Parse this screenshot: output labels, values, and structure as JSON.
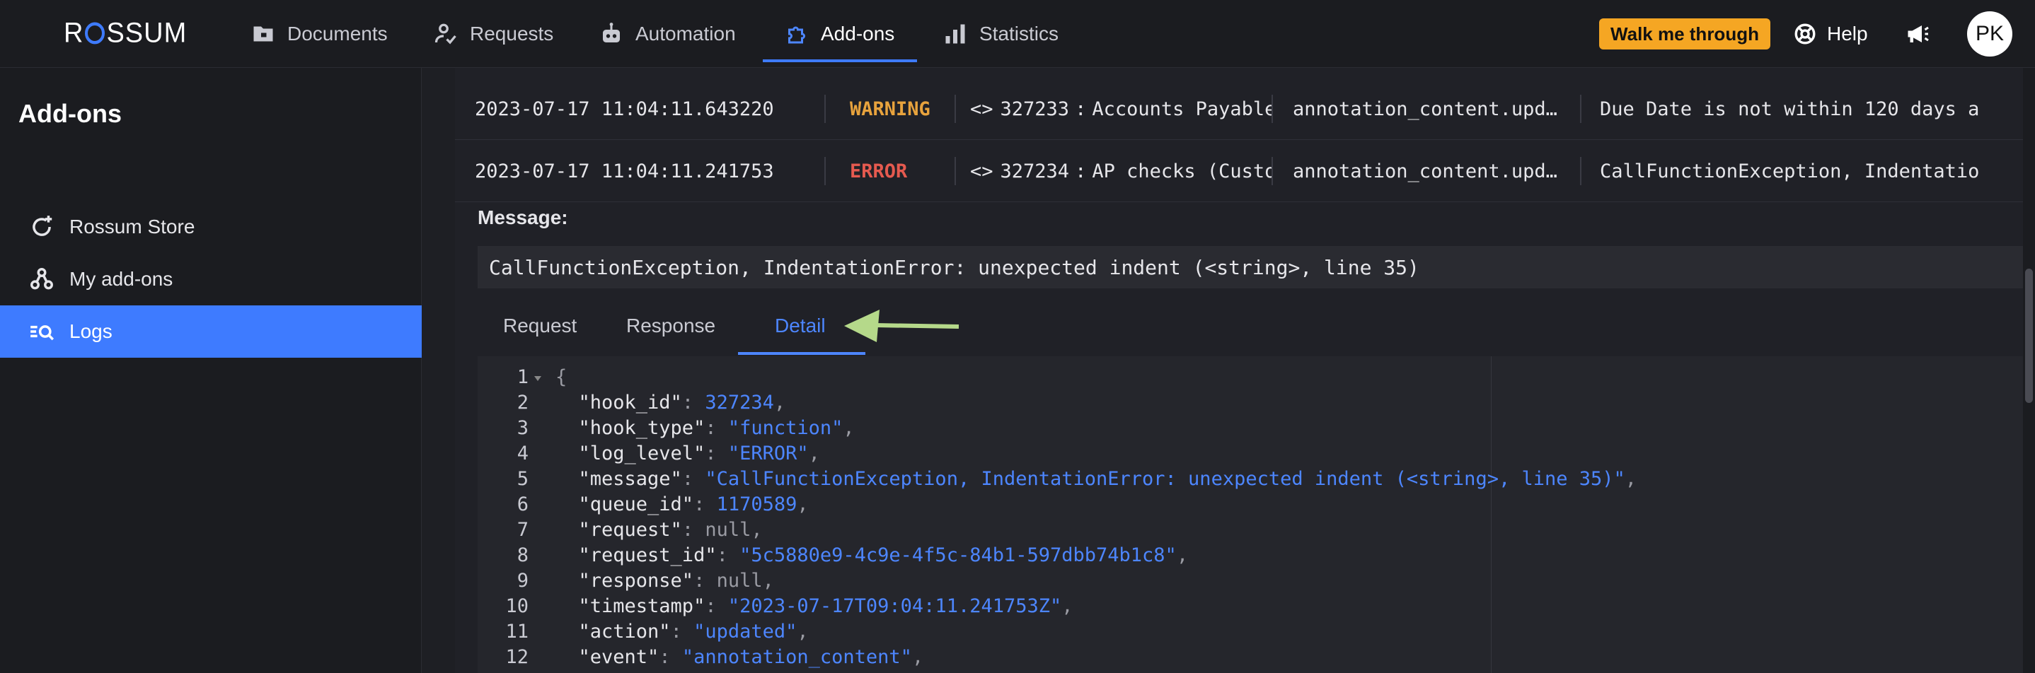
{
  "app": {
    "logo_text": "ROSSUM"
  },
  "nav": {
    "items": [
      {
        "label": "Documents",
        "icon": "folder-icon"
      },
      {
        "label": "Requests",
        "icon": "user-check-icon"
      },
      {
        "label": "Automation",
        "icon": "robot-icon"
      },
      {
        "label": "Add-ons",
        "icon": "puzzle-icon",
        "active": true
      },
      {
        "label": "Statistics",
        "icon": "bar-chart-icon"
      }
    ],
    "walk_label": "Walk me through",
    "help_label": "Help",
    "avatar_initials": "PK"
  },
  "sidebar": {
    "title": "Add-ons",
    "items": [
      {
        "label": "Rossum Store",
        "icon": "refresh-plus-icon"
      },
      {
        "label": "My add-ons",
        "icon": "nodes-icon"
      },
      {
        "label": "Logs",
        "icon": "search-list-icon",
        "active": true
      }
    ]
  },
  "logs": {
    "rows": [
      {
        "timestamp": "2023-07-17 11:04:11.643220",
        "level": "WARNING",
        "hook_id": "327233",
        "hook_name": "Accounts Payable",
        "event": "annotation_content.upd…",
        "message": "Due Date is not within 120 days a"
      },
      {
        "timestamp": "2023-07-17 11:04:11.241753",
        "level": "ERROR",
        "hook_id": "327234",
        "hook_name": "AP checks (Custo",
        "event": "annotation_content.upd…",
        "message": "CallFunctionException, Indentatio"
      }
    ]
  },
  "detail": {
    "message_label": "Message:",
    "message_value": "CallFunctionException, IndentationError: unexpected indent (<string>, line 35)",
    "tabs": [
      "Request",
      "Response",
      "Detail"
    ],
    "active_tab": "Detail"
  },
  "code": {
    "lines": [
      {
        "n": "1",
        "parts": [
          [
            "p",
            "{"
          ]
        ]
      },
      {
        "n": "2",
        "parts": [
          [
            "k",
            "  \"hook_id\""
          ],
          [
            "p",
            ": "
          ],
          [
            "n",
            "327234"
          ],
          [
            "p",
            ","
          ]
        ]
      },
      {
        "n": "3",
        "parts": [
          [
            "k",
            "  \"hook_type\""
          ],
          [
            "p",
            ": "
          ],
          [
            "s",
            "\"function\""
          ],
          [
            "p",
            ","
          ]
        ]
      },
      {
        "n": "4",
        "parts": [
          [
            "k",
            "  \"log_level\""
          ],
          [
            "p",
            ": "
          ],
          [
            "s",
            "\"ERROR\""
          ],
          [
            "p",
            ","
          ]
        ]
      },
      {
        "n": "5",
        "parts": [
          [
            "k",
            "  \"message\""
          ],
          [
            "p",
            ": "
          ],
          [
            "s",
            "\"CallFunctionException, IndentationError: unexpected indent (<string>, line 35)\""
          ],
          [
            "p",
            ","
          ]
        ]
      },
      {
        "n": "6",
        "parts": [
          [
            "k",
            "  \"queue_id\""
          ],
          [
            "p",
            ": "
          ],
          [
            "n",
            "1170589"
          ],
          [
            "p",
            ","
          ]
        ]
      },
      {
        "n": "7",
        "parts": [
          [
            "k",
            "  \"request\""
          ],
          [
            "p",
            ": "
          ],
          [
            "nul",
            "null"
          ],
          [
            "p",
            ","
          ]
        ]
      },
      {
        "n": "8",
        "parts": [
          [
            "k",
            "  \"request_id\""
          ],
          [
            "p",
            ": "
          ],
          [
            "s",
            "\"5c5880e9-4c9e-4f5c-84b1-597dbb74b1c8\""
          ],
          [
            "p",
            ","
          ]
        ]
      },
      {
        "n": "9",
        "parts": [
          [
            "k",
            "  \"response\""
          ],
          [
            "p",
            ": "
          ],
          [
            "nul",
            "null"
          ],
          [
            "p",
            ","
          ]
        ]
      },
      {
        "n": "10",
        "parts": [
          [
            "k",
            "  \"timestamp\""
          ],
          [
            "p",
            ": "
          ],
          [
            "s",
            "\"2023-07-17T09:04:11.241753Z\""
          ],
          [
            "p",
            ","
          ]
        ]
      },
      {
        "n": "11",
        "parts": [
          [
            "k",
            "  \"action\""
          ],
          [
            "p",
            ": "
          ],
          [
            "s",
            "\"updated\""
          ],
          [
            "p",
            ","
          ]
        ]
      },
      {
        "n": "12",
        "parts": [
          [
            "k",
            "  \"event\""
          ],
          [
            "p",
            ": "
          ],
          [
            "s",
            "\"annotation_content\""
          ],
          [
            "p",
            ","
          ]
        ]
      }
    ]
  },
  "colors": {
    "accent": "#3e7bff",
    "warning": "#e8a33d",
    "error": "#e55a4f",
    "walk_button": "#f5a623",
    "arrow": "#b5d98a"
  }
}
